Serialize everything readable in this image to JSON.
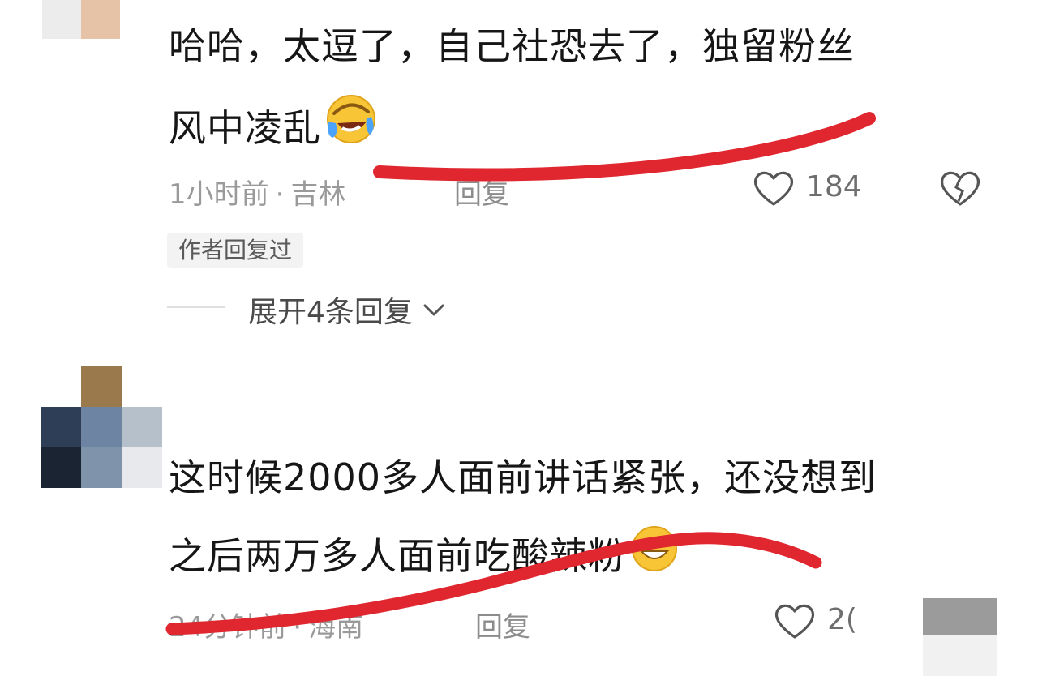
{
  "comments": [
    {
      "text_line1": "哈哈，太逗了，自己社恐去了，独留粉丝",
      "text_line2": "风中凌乱",
      "emoji": "rofl-emoji",
      "time": "1小时前",
      "location": "吉林",
      "reply_label": "回复",
      "likes": "184",
      "author_badge": "作者回复过",
      "expand_label": "展开4条回复"
    },
    {
      "text_line1": "这时候2000多人面前讲话紧张，还没想到",
      "text_line2": "之后两万多人面前吃酸辣粉",
      "emoji": "grin-emoji",
      "time": "24分钟前",
      "location": "海南",
      "reply_label": "回复",
      "likes": "2("
    }
  ],
  "colors": {
    "marker": "#e0262f",
    "meta_text": "#9a9a9a",
    "body_text": "#161616"
  },
  "icons": [
    "heart-icon",
    "broken-heart-icon",
    "chevron-down-icon"
  ]
}
